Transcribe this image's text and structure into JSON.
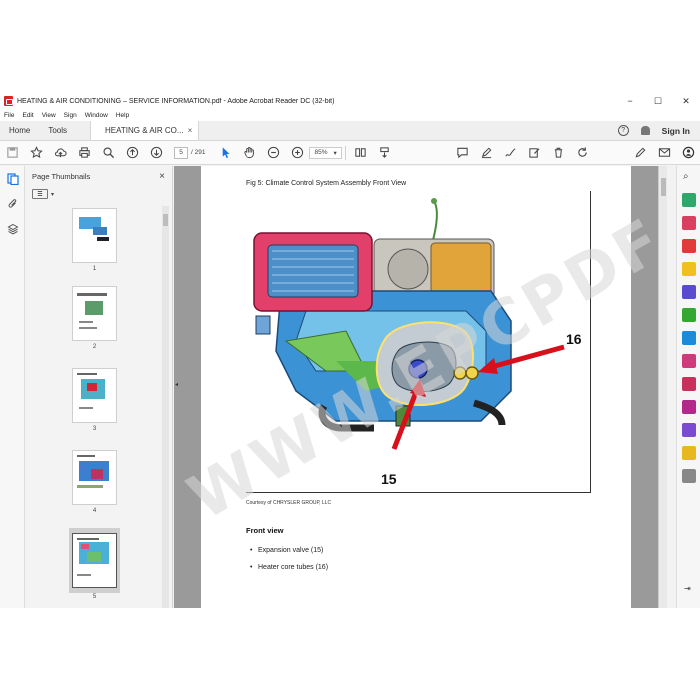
{
  "window": {
    "title": "HEATING & AIR CONDITIONING – SERVICE INFORMATION.pdf - Adobe Acrobat Reader DC (32-bit)",
    "minimize": "−",
    "maximize": "☐",
    "close": "✕"
  },
  "menu": [
    "File",
    "Edit",
    "View",
    "Sign",
    "Window",
    "Help"
  ],
  "tabs": {
    "home": "Home",
    "tools": "Tools",
    "document": "HEATING & AIR CO...",
    "close": "×",
    "help": "?",
    "sign_in": "Sign In"
  },
  "toolbar": {
    "current_page": "5",
    "total_pages": "/ 291",
    "zoom": "85%",
    "zoom_caret": "▾"
  },
  "thumbnails": {
    "title": "Page Thumbnails",
    "close": "×",
    "options_icon": "☰",
    "pages": [
      {
        "label": "1",
        "selected": false
      },
      {
        "label": "2",
        "selected": false
      },
      {
        "label": "3",
        "selected": false
      },
      {
        "label": "4",
        "selected": false
      },
      {
        "label": "5",
        "selected": true
      }
    ]
  },
  "document": {
    "figure_caption": "Fig 5: Climate Control System Assembly Front View",
    "courtesy": "Courtesy of CHRYSLER GROUP, LLC",
    "callout_16": "16",
    "callout_15": "15",
    "section_heading": "Front view",
    "bullets": [
      "Expansion valve (15)",
      "Heater core tubes (16)"
    ],
    "watermark": "WWW.EPCPDF.COM"
  },
  "colors": {
    "accent_red": "#d8101c",
    "viewer_bg": "#9a9a9a",
    "panel_bg": "#f3f3f3"
  }
}
